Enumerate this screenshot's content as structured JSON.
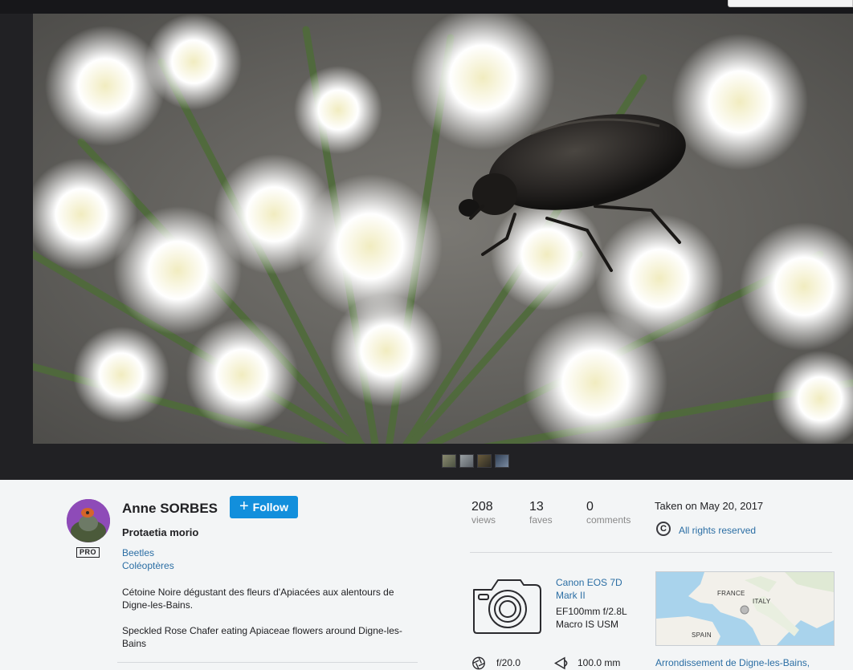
{
  "photo": {
    "alt": "Protaetia morio"
  },
  "thumbnails": [
    "thumb-1",
    "thumb-2",
    "thumb-3",
    "thumb-4"
  ],
  "owner": {
    "name": "Anne SORBES",
    "badge": "PRO",
    "follow_label": "Follow"
  },
  "photo_info": {
    "title": "Protaetia morio",
    "albums": [
      "Beetles",
      "Coléoptères"
    ],
    "description": [
      "Cétoine Noire dégustant des fleurs d'Apiacées aux alentours de Digne-les-Bains.",
      "Speckled Rose Chafer eating Apiaceae flowers around Digne-les-Bains"
    ]
  },
  "stats": {
    "views": {
      "value": "208",
      "label": "views"
    },
    "faves": {
      "value": "13",
      "label": "faves"
    },
    "comments": {
      "value": "0",
      "label": "comments"
    }
  },
  "taken": "Taken on May 20, 2017",
  "license": {
    "icon": "cc-icon",
    "symbol": "C",
    "label": "All rights reserved"
  },
  "camera": {
    "model": "Canon EOS 7D Mark II",
    "lens": "EF100mm f/2.8L Macro IS USM"
  },
  "map": {
    "labels": [
      "FRANCE",
      "ITALY",
      "SPAIN"
    ],
    "location": "Arrondissement de Digne-les-Bains,"
  },
  "exif": {
    "aperture": "f/20.0",
    "focal_length": "100.0 mm"
  },
  "colors": {
    "accent": "#128fdc",
    "link": "#2b6ea4",
    "stage_bg": "#212124"
  }
}
